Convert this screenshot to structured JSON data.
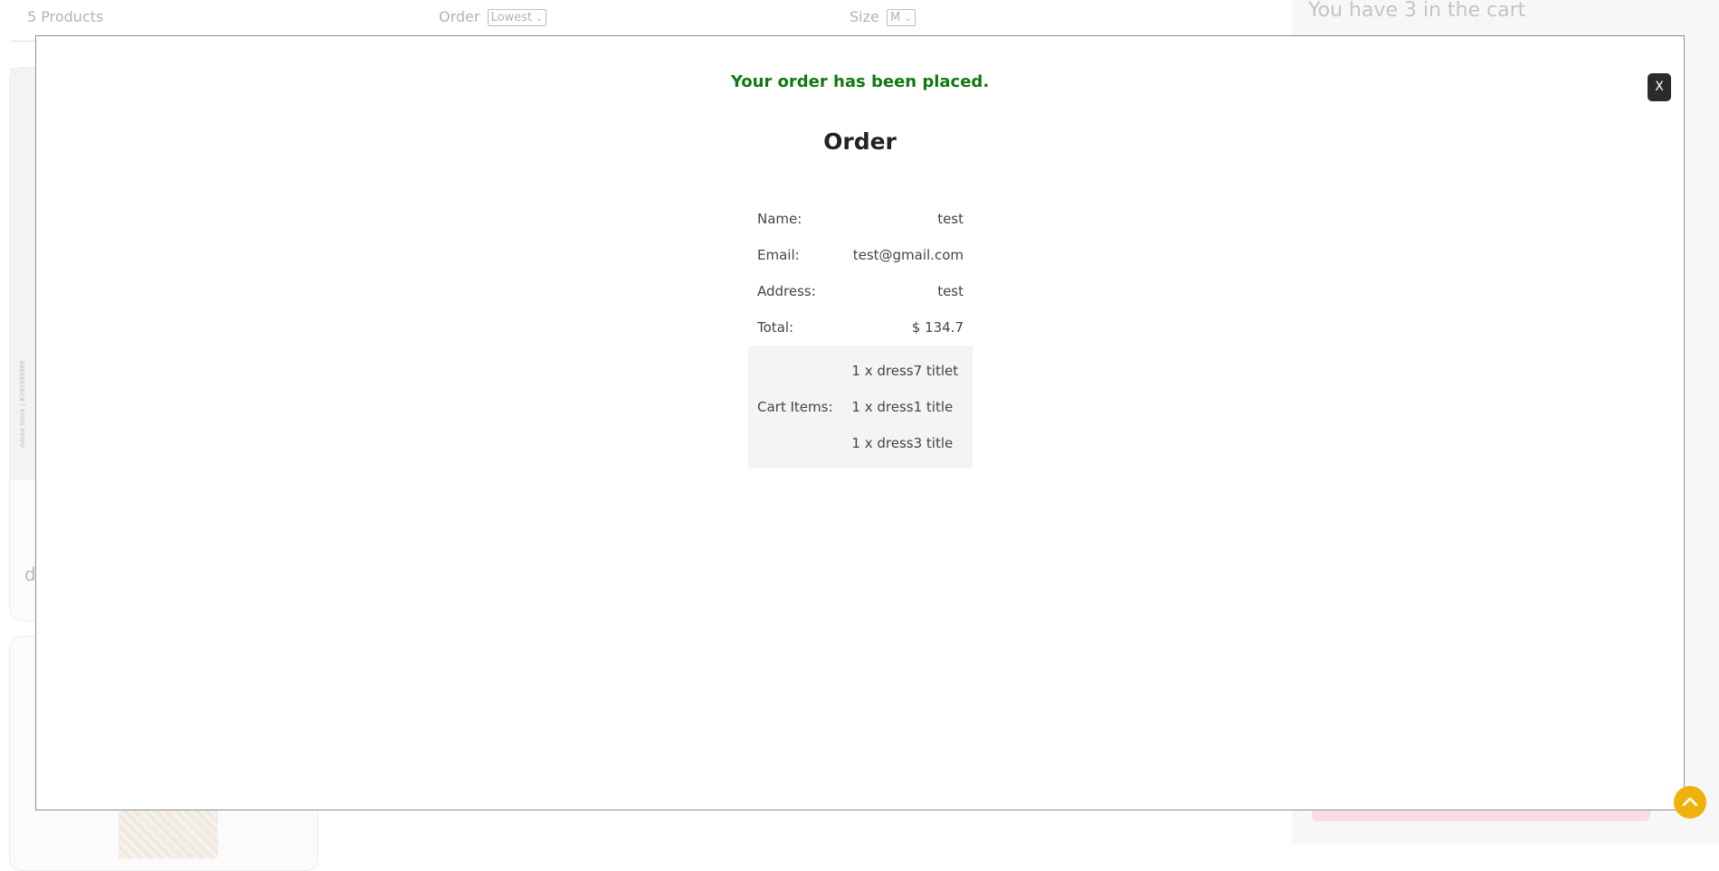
{
  "filters": {
    "product_count": "5 Products",
    "order_label": "Order",
    "order_value": "Lowest",
    "size_label": "Size",
    "size_value": "M"
  },
  "cart": {
    "header": "You have 3 in the cart"
  },
  "background_card": {
    "title_fragment": "d",
    "watermark": "Adobe Stock | #292595869"
  },
  "modal": {
    "close_label": "X",
    "success_message": "Your order has been placed.",
    "title": "Order",
    "details": [
      {
        "label": "Name:",
        "value": "test"
      },
      {
        "label": "Email:",
        "value": "test@gmail.com"
      },
      {
        "label": "Address:",
        "value": "test"
      },
      {
        "label": "Total:",
        "value": "$ 134.7"
      }
    ],
    "cart_items_label": "Cart Items:",
    "cart_items": [
      "1 x dress7 titlet",
      "1 x dress1 title",
      "1 x dress3 title"
    ]
  },
  "colors": {
    "success": "#0f7a0f",
    "close_button": "#2b2b2b",
    "scroll_top": "#f0b10a",
    "cart_bar": "#f8dde2"
  },
  "icons": {
    "scroll_top": "chevron-up-icon",
    "select_caret": "chevron-down-icon"
  }
}
